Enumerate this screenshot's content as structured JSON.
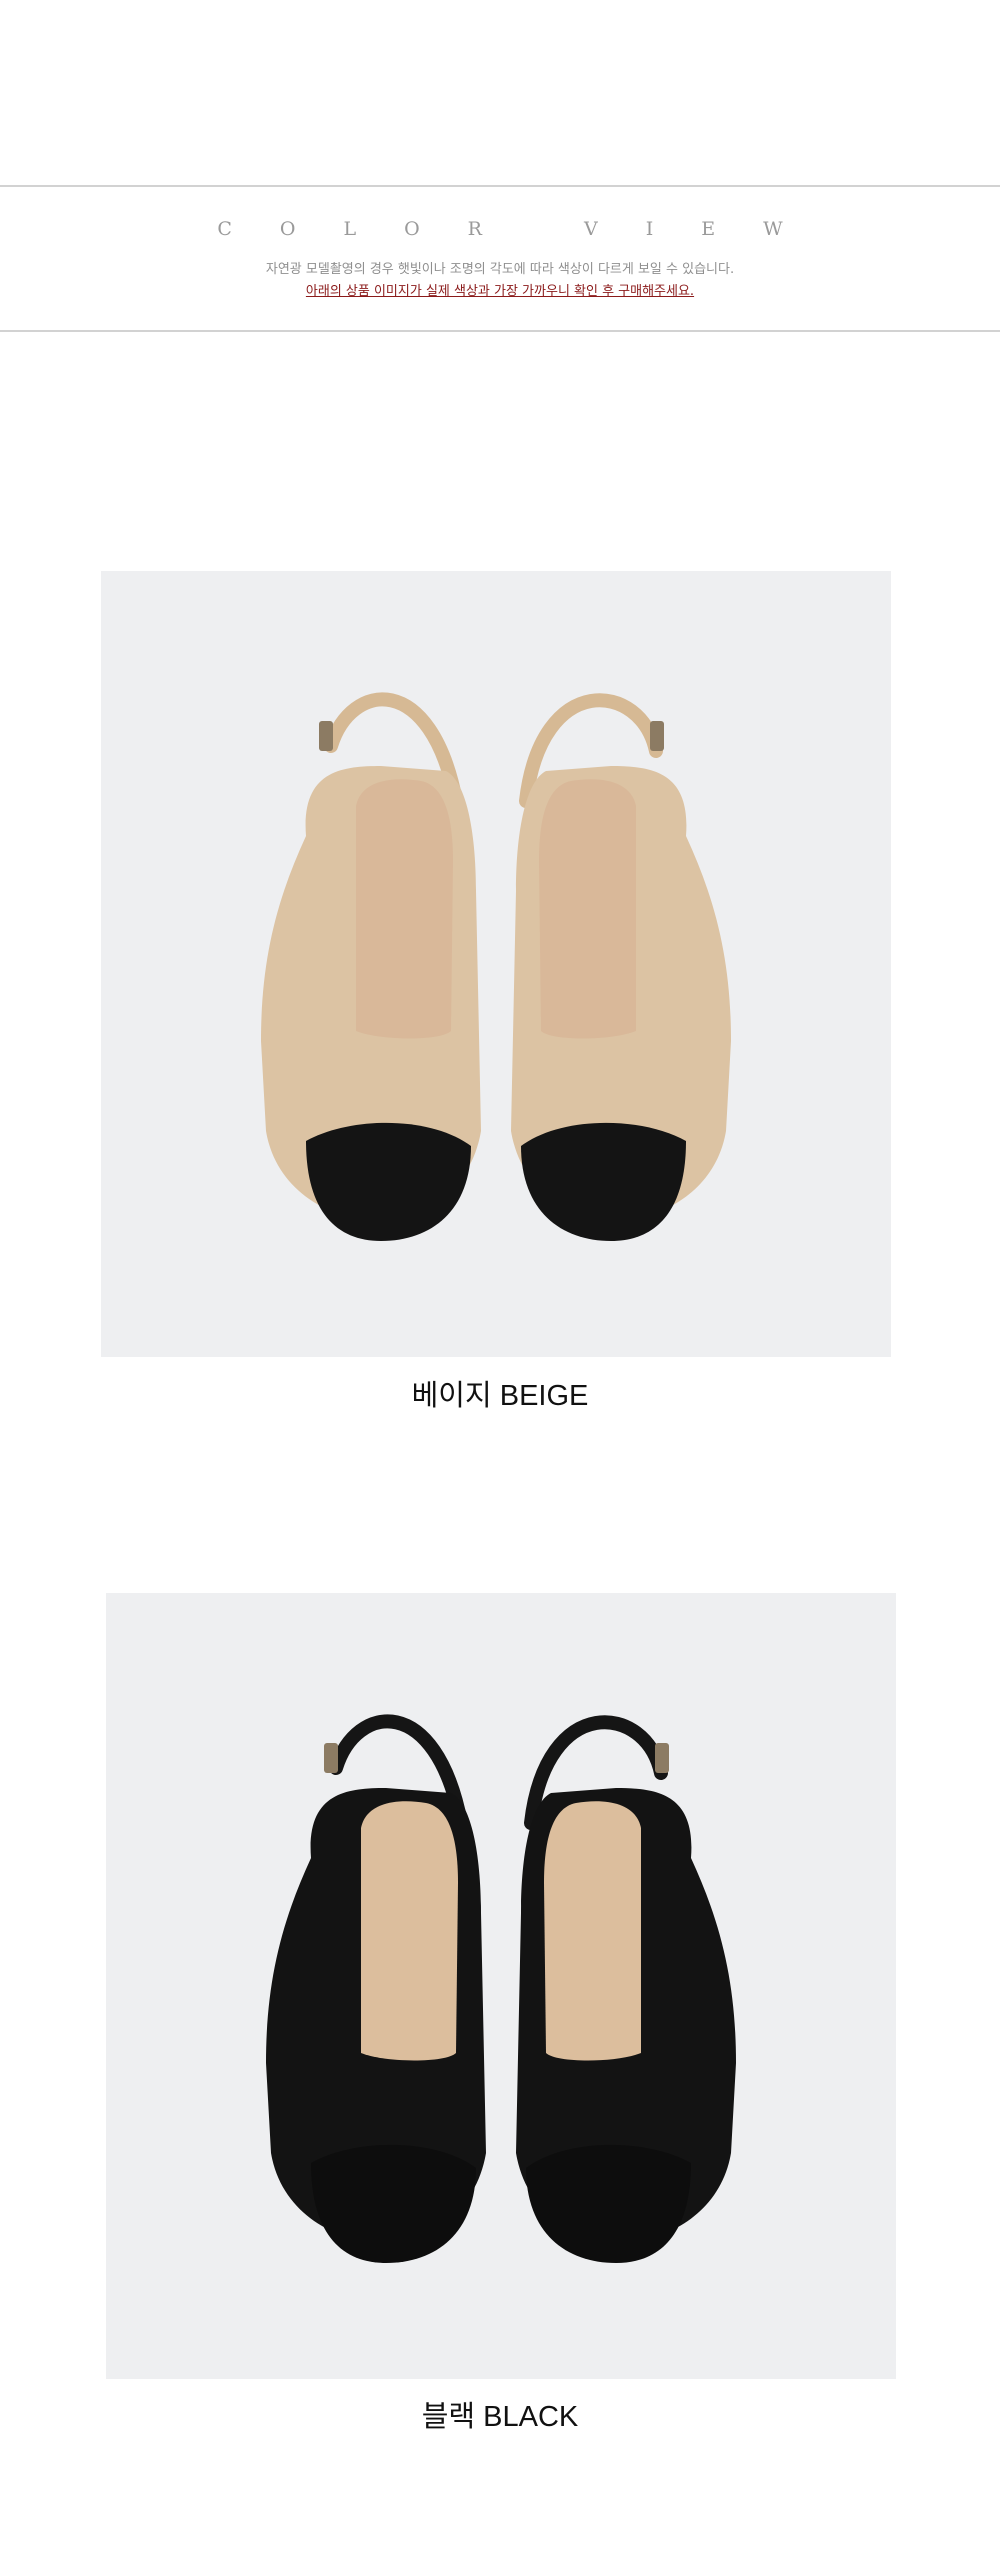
{
  "header": {
    "title": "COLOR VIEW",
    "notice_line1": "자연광 모델촬영의 경우 햇빛이나 조명의 각도에 따라 색상이 다르게 보일 수 있습니다.",
    "notice_line2": "아래의 상품 이미지가 실제 색상과 가장 가까우니 확인 후 구매해주세요."
  },
  "colors": [
    {
      "caption": "베이지 BEIGE",
      "upper_color": "#dcc3a3",
      "insole_color": "#d9b899",
      "toe_color": "#141414",
      "strap_color": "#d6b994"
    },
    {
      "caption": "블랙 BLACK",
      "upper_color": "#131313",
      "insole_color": "#dcbe9d",
      "toe_color": "#0d0d0d",
      "strap_color": "#151515"
    }
  ]
}
